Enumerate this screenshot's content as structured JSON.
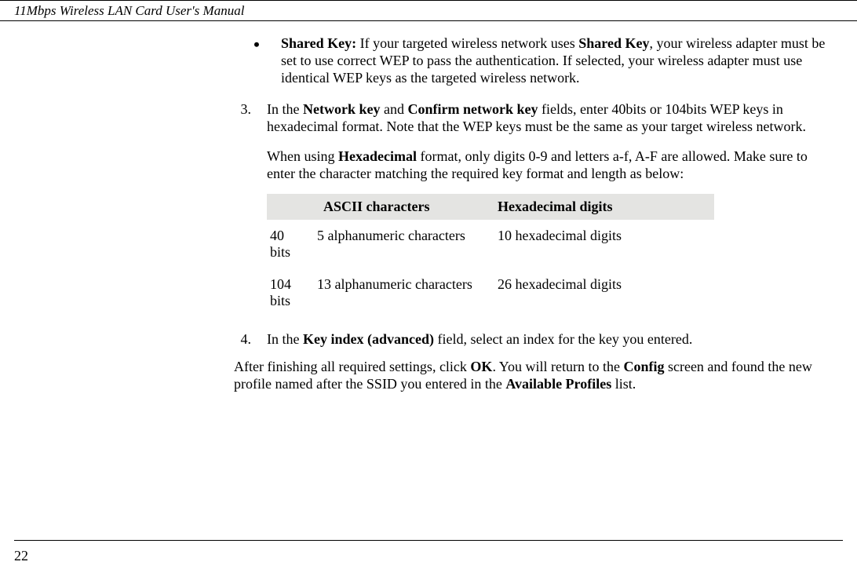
{
  "header": {
    "title": "11Mbps Wireless LAN Card User's Manual"
  },
  "bullet": {
    "label": "Shared Key:",
    "text": " If your targeted wireless network uses ",
    "bold1": "Shared Key",
    "text2": ", your wireless adapter must be set to use correct WEP to pass the authentication. If selected, your wireless adapter must use identical WEP keys as the targeted wireless network."
  },
  "step3": {
    "num": "3.",
    "pre": "In the ",
    "b1": "Network key",
    "mid": " and ",
    "b2": "Confirm network key",
    "post": " fields, enter 40bits or 104bits WEP keys in hexadecimal format. Note that the WEP keys must be the same as your target wireless network."
  },
  "hexpara": {
    "pre": "When using ",
    "b": "Hexadecimal",
    "post": " format, only digits 0-9 and letters a-f, A-F are allowed. Make sure to enter the character matching the required key format and length as below:"
  },
  "table": {
    "h1": "ASCII characters",
    "h2": "Hexadecimal digits",
    "r1c1": "40 bits",
    "r1c2": "5 alphanumeric characters",
    "r1c3": "10 hexadecimal digits",
    "r2c1": "104 bits",
    "r2c2": "13 alphanumeric characters",
    "r2c3": "26 hexadecimal digits"
  },
  "step4": {
    "num": "4.",
    "pre": "In the ",
    "b": "Key index (advanced)",
    "post": " field, select an index for the key you entered."
  },
  "after": {
    "pre": "After finishing all required settings, click ",
    "b1": "OK",
    "mid": ". You will return to the ",
    "b2": "Config",
    "mid2": " screen and found the new profile named after the SSID you entered in the ",
    "b3": "Available Profiles",
    "post": " list."
  },
  "pagenum": "22"
}
